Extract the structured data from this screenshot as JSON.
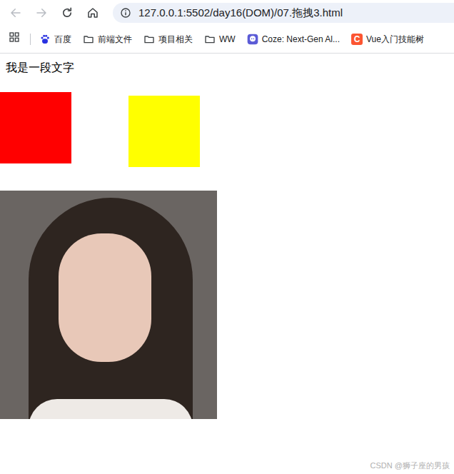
{
  "browser": {
    "url": "127.0.0.1:5502/day16(DOM)/07.拖拽3.html",
    "nav": [
      {
        "name": "back",
        "disabled": true
      },
      {
        "name": "forward",
        "disabled": true
      },
      {
        "name": "reload",
        "disabled": false
      },
      {
        "name": "home",
        "disabled": false
      }
    ],
    "bookmarks": [
      {
        "label": "百度",
        "kind": "baidu"
      },
      {
        "label": "前端文件",
        "kind": "folder"
      },
      {
        "label": "项目相关",
        "kind": "folder"
      },
      {
        "label": "WW",
        "kind": "folder"
      },
      {
        "label": "Coze: Next-Gen Al...",
        "kind": "coze"
      },
      {
        "label": "Vue入门技能树",
        "kind": "csdn",
        "icon_text": "C"
      }
    ]
  },
  "page": {
    "text": "我是一段文字",
    "boxes": [
      {
        "color": "#ff0000"
      },
      {
        "color": "#ffff00"
      }
    ],
    "photo": true
  },
  "watermark": "CSDN @狮子座的男孩"
}
